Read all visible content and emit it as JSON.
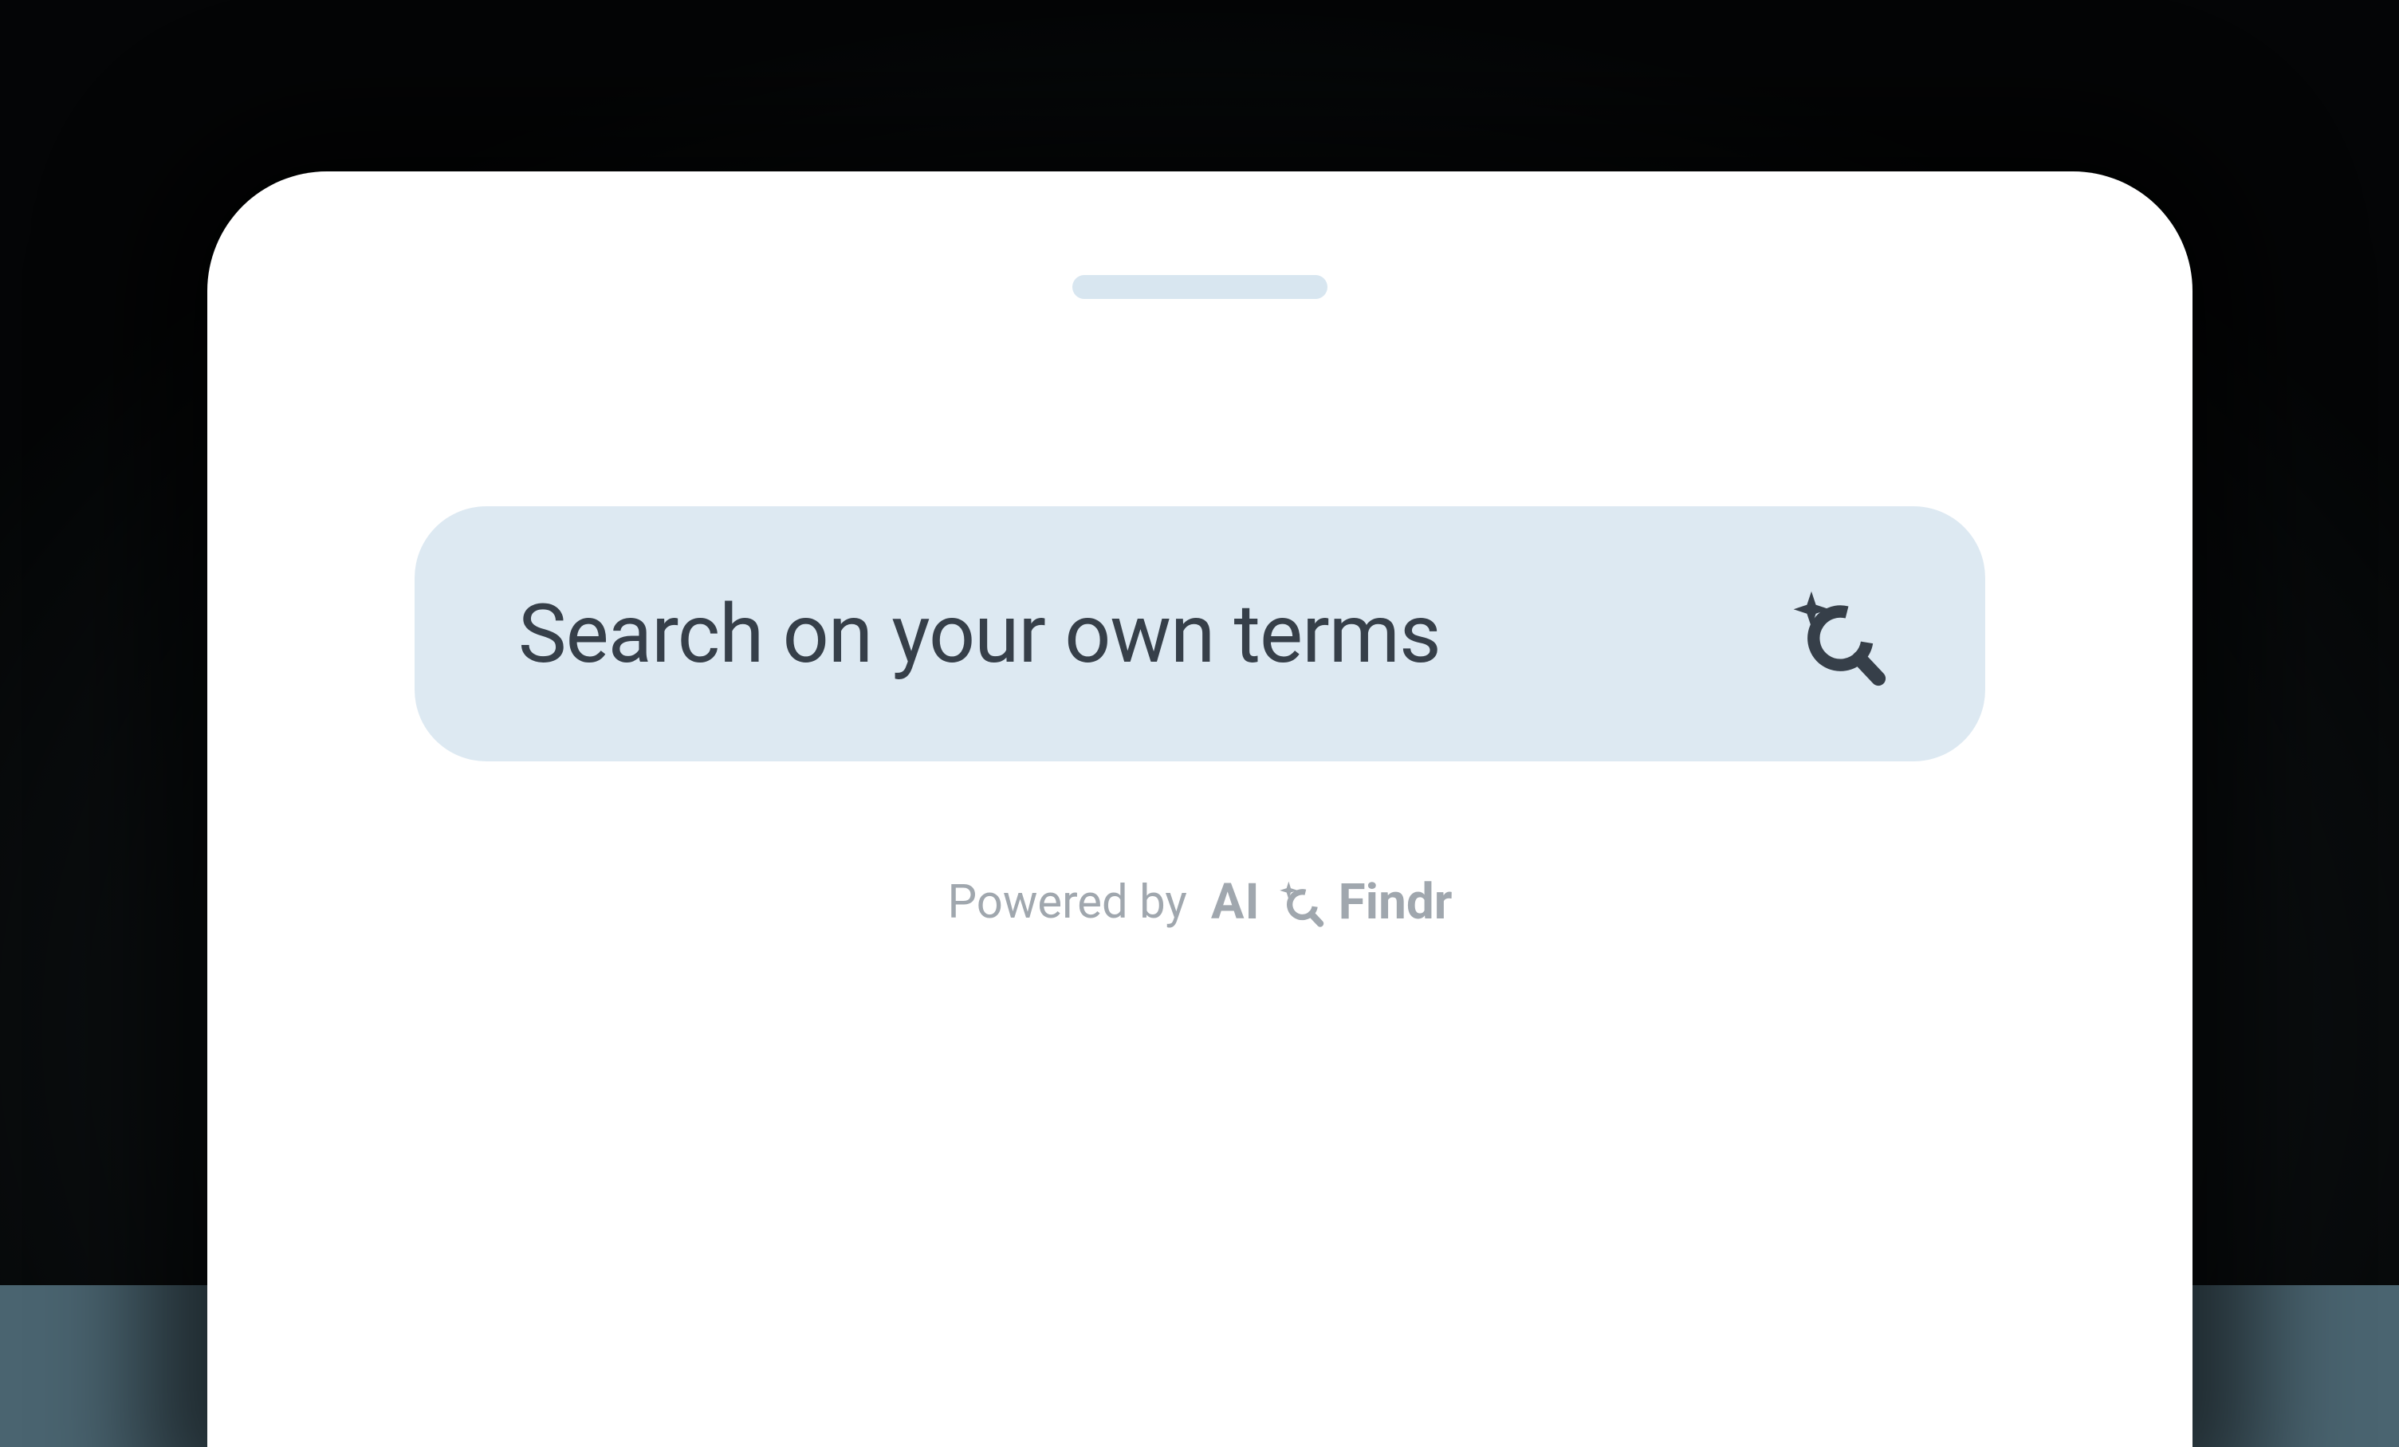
{
  "search": {
    "placeholder": "Search on your own terms"
  },
  "footer": {
    "powered_label": "Powered by",
    "brand_ai": "AI",
    "brand_name": "Findr"
  },
  "colors": {
    "background": "#4a6470",
    "phone": "#ffffff",
    "search_bg": "#dde9f2",
    "text_dark": "#363f49",
    "text_muted": "#a0a7ae",
    "notch": "#d8e6f0"
  }
}
